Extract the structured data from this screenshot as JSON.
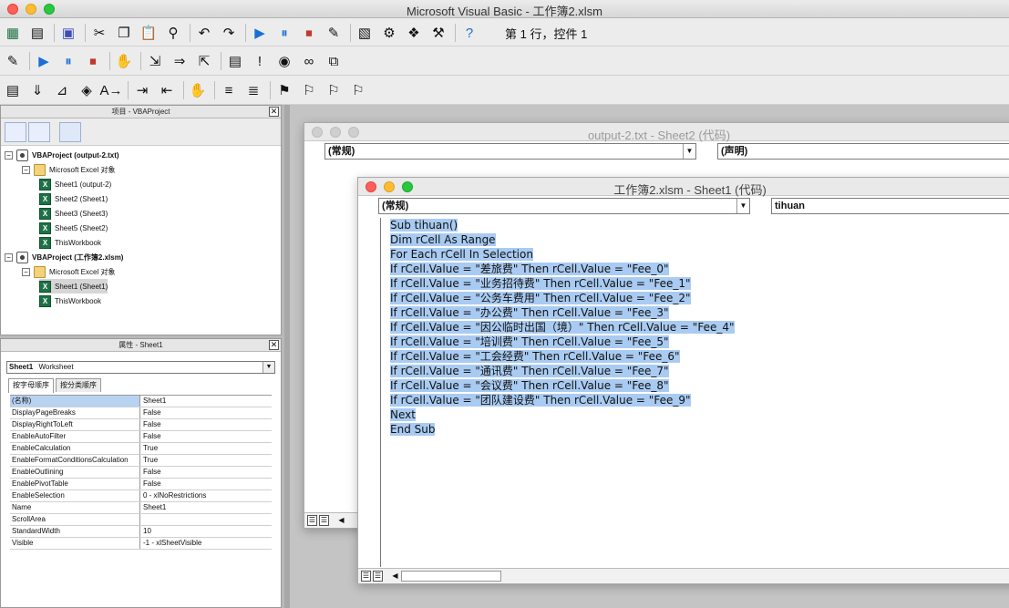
{
  "app": {
    "title": "Microsoft Visual Basic - 工作簿2.xlsm"
  },
  "toolbar": {
    "status": "第 1 行，控件 1",
    "row1_icons": [
      "excel-icon",
      "insert-module-icon",
      "save-icon",
      "cut-icon",
      "copy-icon",
      "paste-icon",
      "find-icon",
      "undo-icon",
      "redo-icon",
      "run-icon",
      "pause-icon",
      "stop-icon",
      "design-mode-icon",
      "project-explorer-icon",
      "properties-icon",
      "object-browser-icon",
      "toolbox-icon",
      "help-icon"
    ],
    "row2_icons": [
      "design-mode-icon",
      "run-icon",
      "pause-icon",
      "stop-icon",
      "hand-icon",
      "step-into-icon",
      "step-over-icon",
      "step-out-icon",
      "locals-icon",
      "immediate-icon",
      "watch-icon",
      "quick-watch-icon",
      "call-stack-icon"
    ],
    "row3_icons": [
      "list-properties-icon",
      "list-constants-icon",
      "quick-info-icon",
      "parameter-info-icon",
      "complete-word-icon",
      "indent-icon",
      "outdent-icon",
      "hand-icon",
      "comment-block-icon",
      "uncomment-block-icon",
      "toggle-bookmark-icon",
      "next-bookmark-icon",
      "previous-bookmark-icon",
      "clear-bookmarks-icon"
    ]
  },
  "project": {
    "title": "项目 - VBAProject",
    "tree": [
      {
        "label": "VBAProject (output-2.txt)",
        "level": 0,
        "icon": "vba",
        "bold": true
      },
      {
        "label": "Microsoft Excel 对象",
        "level": 1,
        "icon": "folder"
      },
      {
        "label": "Sheet1 (output-2)",
        "level": 2,
        "icon": "excel"
      },
      {
        "label": "Sheet2 (Sheet1)",
        "level": 2,
        "icon": "excel"
      },
      {
        "label": "Sheet3 (Sheet3)",
        "level": 2,
        "icon": "excel"
      },
      {
        "label": "Sheet5 (Sheet2)",
        "level": 2,
        "icon": "excel"
      },
      {
        "label": "ThisWorkbook",
        "level": 2,
        "icon": "excel"
      },
      {
        "label": "VBAProject (工作簿2.xlsm)",
        "level": 0,
        "icon": "vba",
        "bold": true
      },
      {
        "label": "Microsoft Excel 对象",
        "level": 1,
        "icon": "folder"
      },
      {
        "label": "Sheet1 (Sheet1)",
        "level": 2,
        "icon": "excel",
        "selected": true
      },
      {
        "label": "ThisWorkbook",
        "level": 2,
        "icon": "excel"
      }
    ]
  },
  "properties": {
    "title": "属性 - Sheet1",
    "object_name": "Sheet1",
    "object_type": "Worksheet",
    "tabs": [
      "按字母顺序",
      "按分类顺序"
    ],
    "rows": [
      {
        "name": "(名称)",
        "value": "Sheet1"
      },
      {
        "name": "DisplayPageBreaks",
        "value": "False"
      },
      {
        "name": "DisplayRightToLeft",
        "value": "False"
      },
      {
        "name": "EnableAutoFilter",
        "value": "False"
      },
      {
        "name": "EnableCalculation",
        "value": "True"
      },
      {
        "name": "EnableFormatConditionsCalculation",
        "value": "True"
      },
      {
        "name": "EnableOutlining",
        "value": "False"
      },
      {
        "name": "EnablePivotTable",
        "value": "False"
      },
      {
        "name": "EnableSelection",
        "value": "0 - xlNoRestrictions"
      },
      {
        "name": "Name",
        "value": "Sheet1"
      },
      {
        "name": "ScrollArea",
        "value": ""
      },
      {
        "name": "StandardWidth",
        "value": "10"
      },
      {
        "name": "Visible",
        "value": "-1 - xlSheetVisible"
      }
    ]
  },
  "back_window": {
    "title": "output-2.txt - Sheet2 (代码)",
    "object_combo": "(常规)",
    "proc_combo": "(声明)"
  },
  "front_window": {
    "title": "工作簿2.xlsm - Sheet1 (代码)",
    "object_combo": "(常规)",
    "proc_combo": "tihuan",
    "code": [
      "Sub tihuan()",
      "Dim rCell As Range",
      "For Each rCell In Selection",
      "If rCell.Value = \"差旅费\" Then rCell.Value = \"Fee_0\"",
      "If rCell.Value = \"业务招待费\" Then rCell.Value = \"Fee_1\"",
      "If rCell.Value = \"公务车费用\" Then rCell.Value = \"Fee_2\"",
      "If rCell.Value = \"办公费\" Then rCell.Value = \"Fee_3\"",
      "If rCell.Value = \"因公临时出国（境）\" Then rCell.Value = \"Fee_4\"",
      "If rCell.Value = \"培训费\" Then rCell.Value = \"Fee_5\"",
      "If rCell.Value = \"工会经费\" Then rCell.Value = \"Fee_6\"",
      "If rCell.Value = \"通讯费\" Then rCell.Value = \"Fee_7\"",
      "If rCell.Value = \"会议费\" Then rCell.Value = \"Fee_8\"",
      "If rCell.Value = \"团队建设费\" Then rCell.Value = \"Fee_9\"",
      "Next",
      "End Sub"
    ]
  },
  "colors": {
    "selection": "#a9cbf2",
    "accent": "#1a73e8"
  }
}
